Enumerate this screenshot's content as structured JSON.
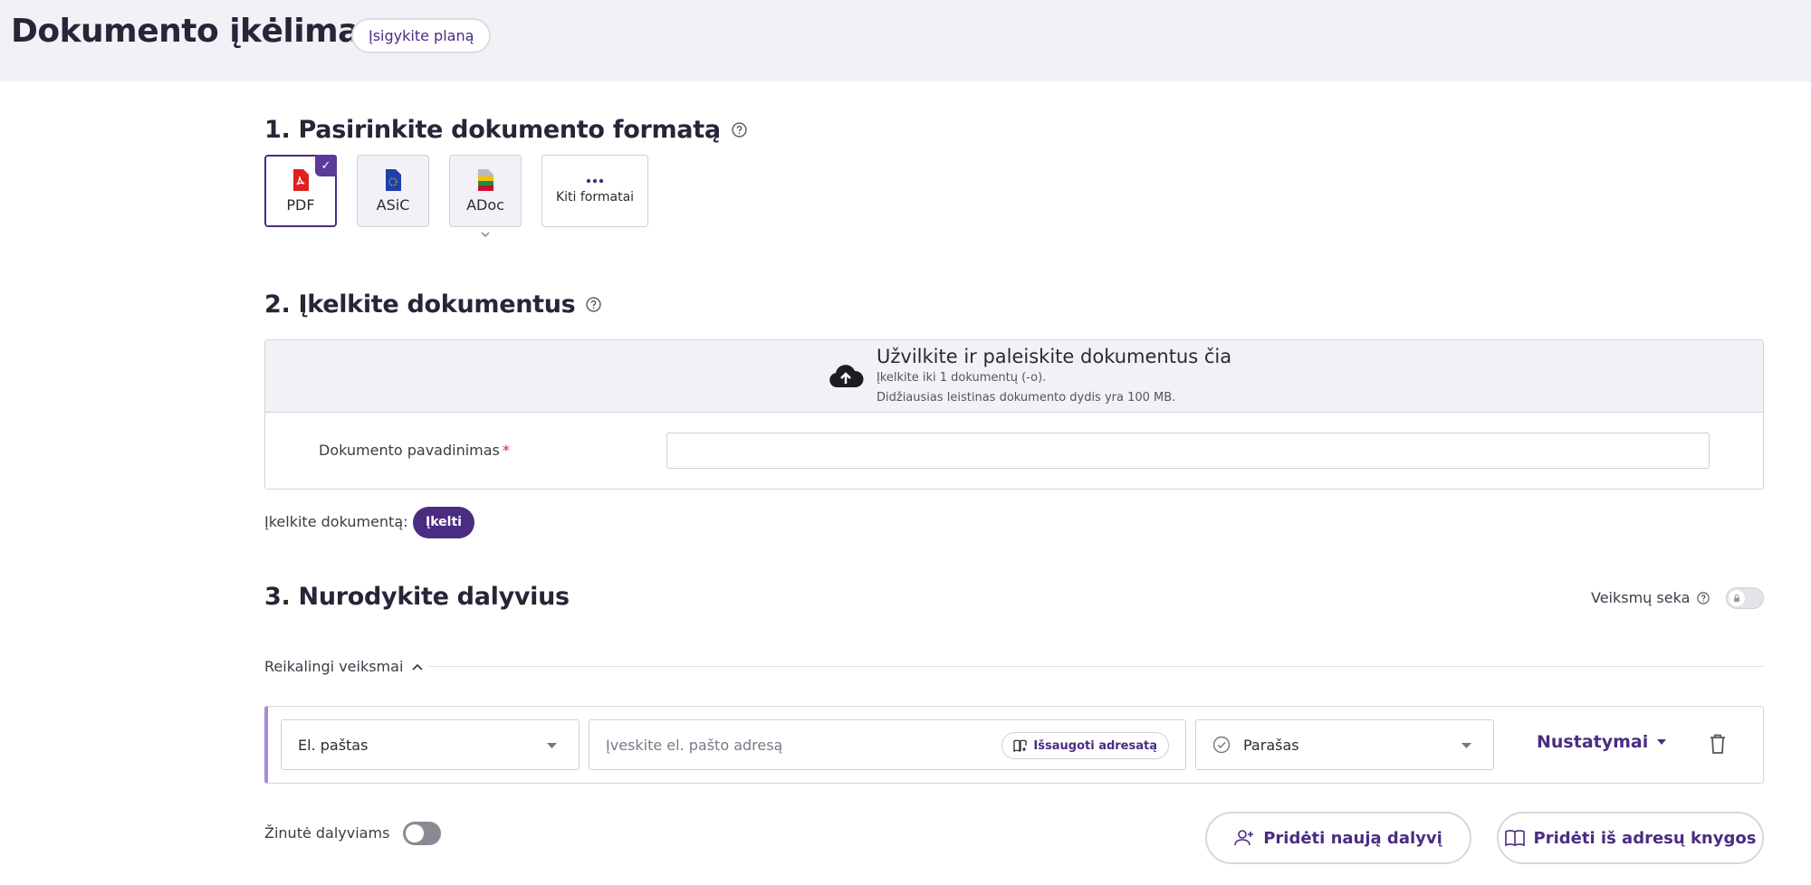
{
  "header": {
    "title": "Dokumento įkėlimas",
    "plan_button": "Įsigykite planą"
  },
  "step1": {
    "title": "1. Pasirinkite dokumento formatą",
    "formats": [
      {
        "label": "PDF",
        "icon": "pdf-icon",
        "selected": true
      },
      {
        "label": "ASiC",
        "icon": "asic-icon",
        "selected": false
      },
      {
        "label": "ADoc",
        "icon": "adoc-icon",
        "selected": false
      },
      {
        "label": "Kiti formatai",
        "icon": "more-icon",
        "selected": false
      }
    ]
  },
  "step2": {
    "title": "2. Įkelkite dokumentus",
    "dropzone": {
      "title": "Užvilkite ir paleiskite dokumentus čia",
      "limit": "Įkelkite iki 1 dokumentų (-o).",
      "max_size": "Didžiausias leistinas dokumento dydis yra 100 MB."
    },
    "doc_name_label": "Dokumento pavadinimas",
    "required_mark": "*",
    "doc_name_value": "",
    "upload_label": "Įkelkite dokumentą:",
    "upload_button": "Įkelti"
  },
  "step3": {
    "title": "3. Nurodykite dalyvius",
    "sequence_label": "Veiksmų seka",
    "sequence_enabled": false,
    "required_actions_label": "Reikalingi veiksmai",
    "participant": {
      "contact_type": "El. paštas",
      "email_placeholder": "Įveskite el. pašto adresą",
      "save_address_button": "Išsaugoti adresatą",
      "action": "Parašas",
      "settings_button": "Nustatymai"
    },
    "message_label": "Žinutė dalyviams",
    "message_enabled": false,
    "add_participant_button": "Pridėti naują dalyvį",
    "add_from_book_button": "Pridėti iš adresų knygos"
  },
  "colors": {
    "accent": "#4b2c82",
    "pdf_red": "#e0201c",
    "asic_blue": "#1f3fa8"
  }
}
